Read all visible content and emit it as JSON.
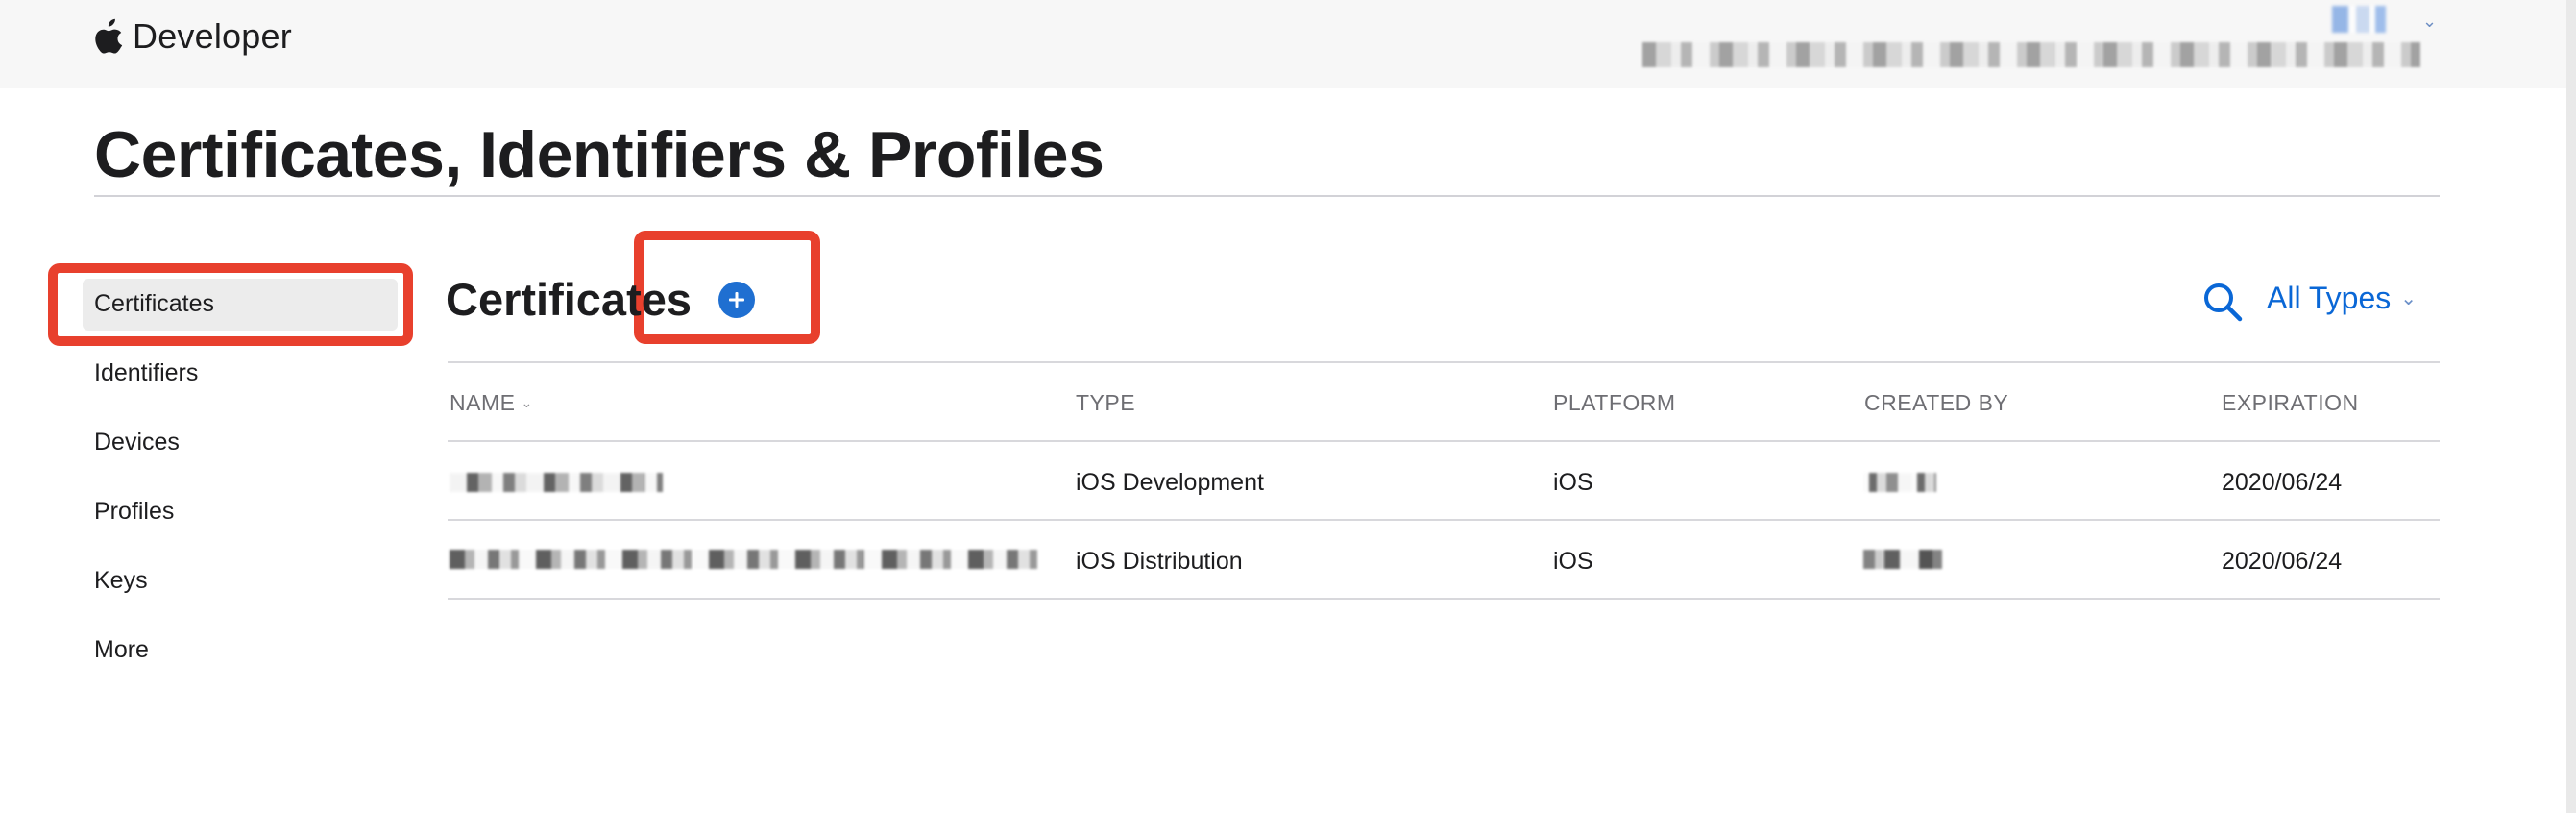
{
  "nav": {
    "brand": "Developer",
    "account_chevron": "⌄"
  },
  "page": {
    "title": "Certificates, Identifiers & Profiles"
  },
  "sidebar": {
    "items": [
      {
        "label": "Certificates",
        "active": true
      },
      {
        "label": "Identifiers",
        "active": false
      },
      {
        "label": "Devices",
        "active": false
      },
      {
        "label": "Profiles",
        "active": false
      },
      {
        "label": "Keys",
        "active": false
      },
      {
        "label": "More",
        "active": false
      }
    ]
  },
  "main": {
    "section_title": "Certificates",
    "add_icon": "plus-circle-icon",
    "search_icon": "search-icon",
    "filter_label": "All Types",
    "filter_chevron": "⌄"
  },
  "table": {
    "columns": [
      "NAME",
      "TYPE",
      "PLATFORM",
      "CREATED BY",
      "EXPIRATION"
    ],
    "sort_chevron": "⌄",
    "rows": [
      {
        "type": "iOS Development",
        "platform": "iOS",
        "expiration": "2020/06/24"
      },
      {
        "type": "iOS Distribution",
        "platform": "iOS",
        "expiration": "2020/06/24"
      }
    ]
  },
  "colors": {
    "accent": "#0a67d6",
    "add_button": "#1f6fd1",
    "highlight": "#e8402d"
  }
}
